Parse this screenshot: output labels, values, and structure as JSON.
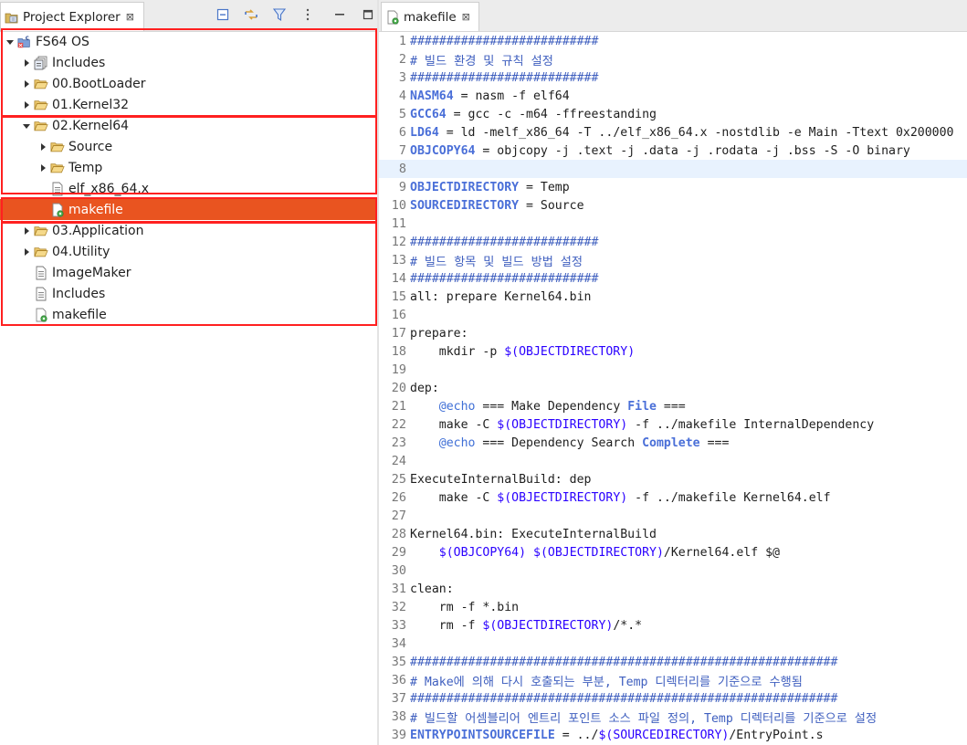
{
  "explorer": {
    "tab_title": "Project Explorer",
    "close_glyph": "⊠",
    "toolbar_icons": [
      "collapse-all-icon",
      "link-with-editor-icon",
      "filter-icon",
      "view-menu-icon",
      "minimize-icon",
      "maximize-icon"
    ],
    "tree": [
      {
        "label": "FS64 OS",
        "depth": 0,
        "arrow": "expanded",
        "icon": "project-icon"
      },
      {
        "label": "Includes",
        "depth": 1,
        "arrow": "collapsed",
        "icon": "includes-icon"
      },
      {
        "label": "00.BootLoader",
        "depth": 1,
        "arrow": "collapsed",
        "icon": "folder-icon"
      },
      {
        "label": "01.Kernel32",
        "depth": 1,
        "arrow": "collapsed",
        "icon": "folder-icon"
      },
      {
        "label": "02.Kernel64",
        "depth": 1,
        "arrow": "expanded",
        "icon": "folder-icon"
      },
      {
        "label": "Source",
        "depth": 2,
        "arrow": "collapsed",
        "icon": "folder-icon"
      },
      {
        "label": "Temp",
        "depth": 2,
        "arrow": "collapsed",
        "icon": "folder-icon"
      },
      {
        "label": "elf_x86_64.x",
        "depth": 2,
        "arrow": "none",
        "icon": "file-icon"
      },
      {
        "label": "makefile",
        "depth": 2,
        "arrow": "none",
        "icon": "makefile-icon",
        "selected": true
      },
      {
        "label": "03.Application",
        "depth": 1,
        "arrow": "collapsed",
        "icon": "folder-icon"
      },
      {
        "label": "04.Utility",
        "depth": 1,
        "arrow": "collapsed",
        "icon": "folder-icon"
      },
      {
        "label": "ImageMaker",
        "depth": 1,
        "arrow": "none",
        "icon": "file-icon"
      },
      {
        "label": "Includes",
        "depth": 1,
        "arrow": "none",
        "icon": "file-icon"
      },
      {
        "label": "makefile",
        "depth": 1,
        "arrow": "none",
        "icon": "makefile-icon"
      }
    ]
  },
  "editor": {
    "tab_title": "makefile",
    "close_glyph": "⊠",
    "current_line": 8,
    "lines": [
      [
        [
          "c",
          "##########################"
        ]
      ],
      [
        [
          "c",
          "# 빌드 환경 및 규칙 설정"
        ]
      ],
      [
        [
          "c",
          "##########################"
        ]
      ],
      [
        [
          "kw",
          "NASM64"
        ],
        [
          "t",
          " = nasm -f elf64"
        ]
      ],
      [
        [
          "kw",
          "GCC64"
        ],
        [
          "t",
          " = gcc -c -m64 -ffreestanding"
        ]
      ],
      [
        [
          "kw",
          "LD64"
        ],
        [
          "t",
          " = ld -melf_x86_64 -T ../elf_x86_64.x -nostdlib -e Main -Ttext 0x200000"
        ]
      ],
      [
        [
          "kw",
          "OBJCOPY64"
        ],
        [
          "t",
          " = objcopy -j .text -j .data -j .rodata -j .bss -S -O binary"
        ]
      ],
      [],
      [
        [
          "kw",
          "OBJECTDIRECTORY"
        ],
        [
          "t",
          " = Temp"
        ]
      ],
      [
        [
          "kw",
          "SOURCEDIRECTORY"
        ],
        [
          "t",
          " = Source"
        ]
      ],
      [],
      [
        [
          "c",
          "##########################"
        ]
      ],
      [
        [
          "c",
          "# 빌드 항목 및 빌드 방법 설정"
        ]
      ],
      [
        [
          "c",
          "##########################"
        ]
      ],
      [
        [
          "t",
          "all: prepare Kernel64.bin"
        ]
      ],
      [],
      [
        [
          "t",
          "prepare:"
        ]
      ],
      [
        [
          "t",
          "    mkdir -p "
        ],
        [
          "var",
          "$(OBJECTDIRECTORY)"
        ]
      ],
      [],
      [
        [
          "t",
          "dep:"
        ]
      ],
      [
        [
          "t",
          "    "
        ],
        [
          "v",
          "@echo"
        ],
        [
          "t",
          " === Make Dependency "
        ],
        [
          "kw",
          "File"
        ],
        [
          "t",
          " ==="
        ]
      ],
      [
        [
          "t",
          "    make -C "
        ],
        [
          "var",
          "$(OBJECTDIRECTORY)"
        ],
        [
          "t",
          " -f ../makefile InternalDependency"
        ]
      ],
      [
        [
          "t",
          "    "
        ],
        [
          "v",
          "@echo"
        ],
        [
          "t",
          " === Dependency Search "
        ],
        [
          "kw",
          "Complete"
        ],
        [
          "t",
          " ==="
        ]
      ],
      [],
      [
        [
          "t",
          "ExecuteInternalBuild: dep"
        ]
      ],
      [
        [
          "t",
          "    make -C "
        ],
        [
          "var",
          "$(OBJECTDIRECTORY)"
        ],
        [
          "t",
          " -f ../makefile Kernel64.elf"
        ]
      ],
      [],
      [
        [
          "t",
          "Kernel64.bin: ExecuteInternalBuild"
        ]
      ],
      [
        [
          "t",
          "    "
        ],
        [
          "var",
          "$(OBJCOPY64)"
        ],
        [
          "t",
          " "
        ],
        [
          "var",
          "$(OBJECTDIRECTORY)"
        ],
        [
          "t",
          "/Kernel64.elf $@"
        ]
      ],
      [],
      [
        [
          "t",
          "clean:"
        ]
      ],
      [
        [
          "t",
          "    rm -f *.bin"
        ]
      ],
      [
        [
          "t",
          "    rm -f "
        ],
        [
          "var",
          "$(OBJECTDIRECTORY)"
        ],
        [
          "t",
          "/*.*"
        ]
      ],
      [],
      [
        [
          "c",
          "###########################################################"
        ]
      ],
      [
        [
          "c",
          "# Make에 의해 다시 호출되는 부분, Temp 디렉터리를 기준으로 수행됨"
        ]
      ],
      [
        [
          "c",
          "###########################################################"
        ]
      ],
      [
        [
          "c",
          "# 빌드할 어셈블리어 엔트리 포인트 소스 파일 정의, Temp 디렉터리를 기준으로 설정"
        ]
      ],
      [
        [
          "kw",
          "ENTRYPOINTSOURCEFILE"
        ],
        [
          "t",
          " = ../"
        ],
        [
          "var",
          "$(SOURCEDIRECTORY)"
        ],
        [
          "t",
          "/EntryPoint.s"
        ]
      ]
    ]
  },
  "colors": {
    "selection": "#e95420",
    "highlight_box": "#ff2020",
    "comment": "#3f5fbf",
    "keyword": "#4a6fd8",
    "variable": "#2a00ff"
  }
}
